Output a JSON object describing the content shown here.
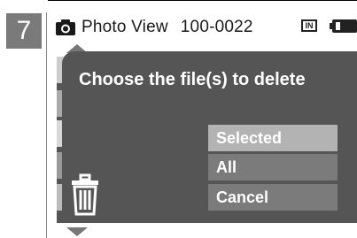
{
  "step_number": "7",
  "header": {
    "title": "Photo View",
    "file_number": "100-0022",
    "memory_indicator": "IN",
    "camera_icon": "camera-icon",
    "battery_icon": "battery-icon"
  },
  "dialog": {
    "prompt": "Choose the file(s) to delete",
    "icon": "trash-icon",
    "options": [
      {
        "label": "Selected",
        "highlighted": true
      },
      {
        "label": "All",
        "highlighted": false
      },
      {
        "label": "Cancel",
        "highlighted": false
      }
    ]
  },
  "colors": {
    "step_badge": "#7a7a7a",
    "dialog_bg": "#555555",
    "menu_highlight": "#b3b3b3",
    "menu_item": "#7b7b7b",
    "text_light": "#ffffff"
  }
}
